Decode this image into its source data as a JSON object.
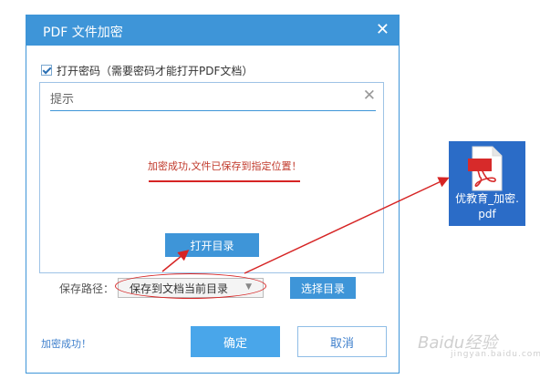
{
  "dialog": {
    "title": "PDF 文件加密",
    "close_glyph": "✕"
  },
  "password": {
    "checked": true,
    "label": "打开密码（需要密码才能打开PDF文档）"
  },
  "panel": {
    "title": "提示",
    "close_glyph": "✕",
    "message": "加密成功,文件已保存到指定位置！",
    "open_button": "打开目录"
  },
  "save_path": {
    "label": "保存路径：",
    "selected": "保存到文档当前目录",
    "arrow": "▼",
    "choose_button": "选择目录"
  },
  "footer": {
    "status": "加密成功！",
    "ok": "确定",
    "cancel": "取消"
  },
  "file": {
    "name_line1": "优教育_加密.",
    "name_line2": "pdf",
    "icon": "pdf-file-icon"
  },
  "watermark": {
    "text": "Baidu经验",
    "sub": "jingyan.baidu.com"
  },
  "colors": {
    "accent": "#3e95d8",
    "annotation_red": "#d62424",
    "desktop_tile": "#2b6cc7"
  }
}
